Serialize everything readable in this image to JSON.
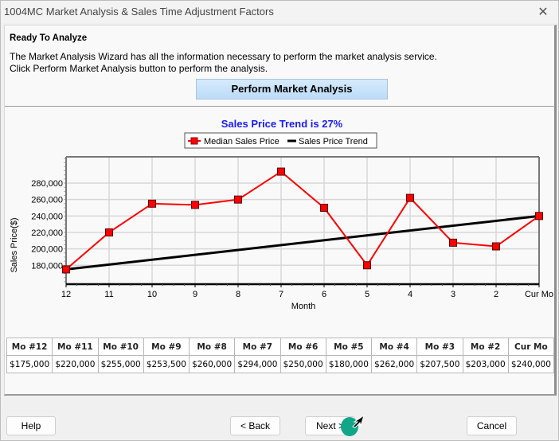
{
  "window": {
    "title": "1004MC Market Analysis & Sales Time Adjustment Factors",
    "close_icon": "close-icon"
  },
  "intro": {
    "heading": "Ready To Analyze",
    "line1": "The Market Analysis Wizard has all the information necessary to perform the market analysis service.",
    "line2": "Click Perform Market Analysis button to perform the analysis.",
    "perform_button": "Perform Market Analysis"
  },
  "chart_data": {
    "type": "line",
    "title": "Sales Price Trend is 27%",
    "xlabel": "Month",
    "ylabel": "Sales Price($)",
    "categories": [
      "12",
      "11",
      "10",
      "9",
      "8",
      "7",
      "6",
      "5",
      "4",
      "3",
      "2",
      "Cur Mo"
    ],
    "series": [
      {
        "name": "Median Sales Price",
        "color": "#ff0000",
        "marker": "square",
        "values": [
          175000,
          220000,
          255000,
          253500,
          260000,
          294000,
          250000,
          180000,
          262000,
          207500,
          203000,
          240000
        ]
      },
      {
        "name": "Sales Price Trend",
        "color": "#000000",
        "marker": "none",
        "values": [
          175000,
          240000
        ],
        "x_positions": [
          "12",
          "Cur Mo"
        ]
      }
    ],
    "yticks": [
      180000,
      200000,
      220000,
      240000,
      260000,
      280000
    ],
    "ytick_labels": [
      "180,000",
      "200,000",
      "220,000",
      "240,000",
      "260,000",
      "280,000"
    ],
    "ylim": [
      157000,
      312000
    ],
    "grid": true,
    "legend_position": "top-center",
    "title_color": "#1a1aff"
  },
  "table": {
    "headers": [
      "Mo #12",
      "Mo #11",
      "Mo #10",
      "Mo #9",
      "Mo #8",
      "Mo #7",
      "Mo #6",
      "Mo #5",
      "Mo #4",
      "Mo #3",
      "Mo #2",
      "Cur Mo"
    ],
    "values": [
      "$175,000",
      "$220,000",
      "$255,000",
      "$253,500",
      "$260,000",
      "$294,000",
      "$250,000",
      "$180,000",
      "$262,000",
      "$207,500",
      "$203,000",
      "$240,000"
    ]
  },
  "buttons": {
    "help": "Help",
    "back": "< Back",
    "next": "Next >",
    "cancel": "Cancel"
  }
}
